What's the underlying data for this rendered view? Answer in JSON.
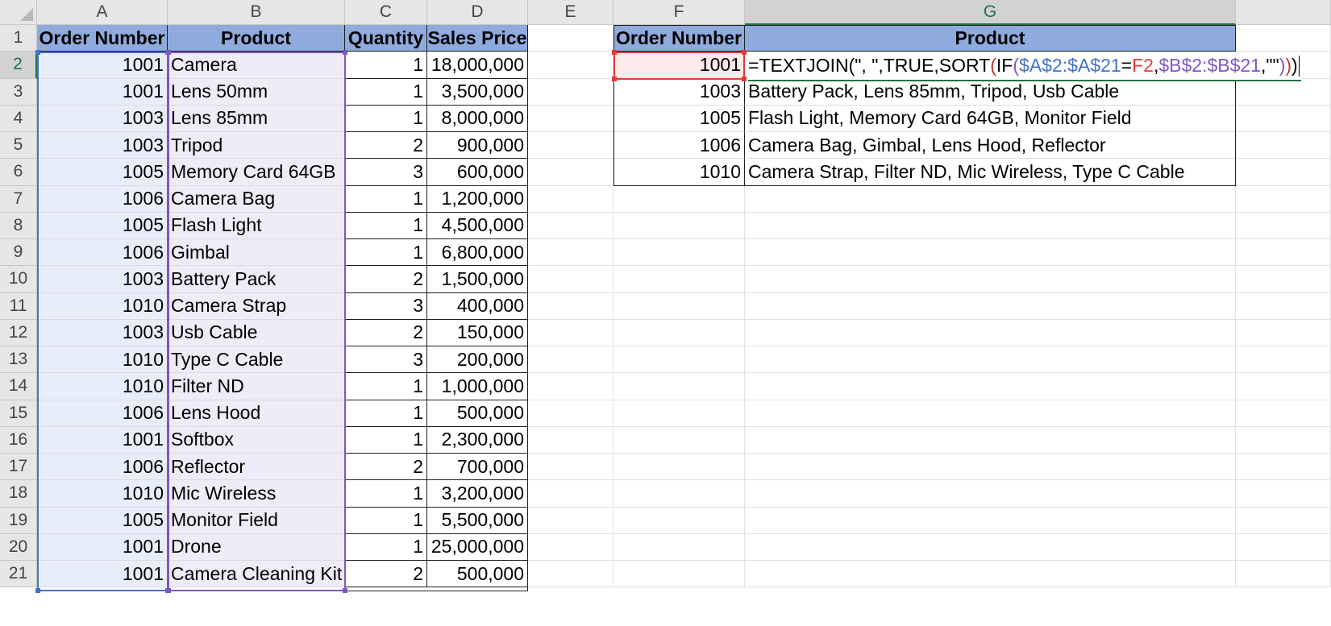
{
  "spreadsheet": {
    "columns": [
      {
        "letter": "A",
        "active": false
      },
      {
        "letter": "B",
        "active": false
      },
      {
        "letter": "C",
        "active": false
      },
      {
        "letter": "D",
        "active": false
      },
      {
        "letter": "E",
        "active": false
      },
      {
        "letter": "F",
        "active": false
      },
      {
        "letter": "G",
        "active": true
      }
    ],
    "row_numbers": [
      "1",
      "2",
      "3",
      "4",
      "5",
      "6",
      "7",
      "8",
      "9",
      "10",
      "11",
      "12",
      "13",
      "14",
      "15",
      "16",
      "17",
      "18",
      "19",
      "20",
      "21"
    ],
    "active_row": "2",
    "orders_table": {
      "headers": [
        "Order Number",
        "Product",
        "Quantity",
        "Sales Price"
      ],
      "rows": [
        [
          "1001",
          "Camera",
          "1",
          "18,000,000"
        ],
        [
          "1001",
          "Lens 50mm",
          "1",
          "3,500,000"
        ],
        [
          "1003",
          "Lens 85mm",
          "1",
          "8,000,000"
        ],
        [
          "1003",
          "Tripod",
          "2",
          "900,000"
        ],
        [
          "1005",
          "Memory Card 64GB",
          "3",
          "600,000"
        ],
        [
          "1006",
          "Camera Bag",
          "1",
          "1,200,000"
        ],
        [
          "1005",
          "Flash Light",
          "1",
          "4,500,000"
        ],
        [
          "1006",
          "Gimbal",
          "1",
          "6,800,000"
        ],
        [
          "1003",
          "Battery Pack",
          "2",
          "1,500,000"
        ],
        [
          "1010",
          "Camera Strap",
          "3",
          "400,000"
        ],
        [
          "1003",
          "Usb Cable",
          "2",
          "150,000"
        ],
        [
          "1010",
          "Type C Cable",
          "3",
          "200,000"
        ],
        [
          "1010",
          "Filter ND",
          "1",
          "1,000,000"
        ],
        [
          "1006",
          "Lens Hood",
          "1",
          "500,000"
        ],
        [
          "1001",
          "Softbox",
          "1",
          "2,300,000"
        ],
        [
          "1006",
          "Reflector",
          "2",
          "700,000"
        ],
        [
          "1010",
          "Mic Wireless",
          "1",
          "3,200,000"
        ],
        [
          "1005",
          "Monitor Field",
          "1",
          "5,500,000"
        ],
        [
          "1001",
          "Drone",
          "1",
          "25,000,000"
        ],
        [
          "1001",
          "Camera Cleaning Kit",
          "2",
          "500,000"
        ]
      ]
    },
    "summary_table": {
      "headers": [
        "Order Number",
        "Product"
      ],
      "rows": [
        [
          "1001",
          ""
        ],
        [
          "1003",
          "Battery Pack, Lens 85mm, Tripod, Usb Cable"
        ],
        [
          "1005",
          "Flash Light, Memory Card 64GB, Monitor Field"
        ],
        [
          "1006",
          "Camera Bag, Gimbal, Lens Hood, Reflector"
        ],
        [
          "1010",
          "Camera Strap, Filter ND, Mic Wireless, Type C Cable"
        ]
      ]
    },
    "formula": {
      "segments": [
        {
          "text": "=TEXTJOIN(\", \",TRUE,SORT",
          "color": "#000000"
        },
        {
          "text": "(",
          "color": "#c0392b"
        },
        {
          "text": "IF",
          "color": "#000000"
        },
        {
          "text": "(",
          "color": "#7e57c2"
        },
        {
          "text": "$A$2:$A$21",
          "color": "#4472c4"
        },
        {
          "text": "=",
          "color": "#000000"
        },
        {
          "text": "F2",
          "color": "#e03c3c"
        },
        {
          "text": ",",
          "color": "#000000"
        },
        {
          "text": "$B$2:$B$21",
          "color": "#7e57c2"
        },
        {
          "text": ",\"\"",
          "color": "#000000"
        },
        {
          "text": ")",
          "color": "#7e57c2"
        },
        {
          "text": ")",
          "color": "#c0392b"
        },
        {
          "text": ")",
          "color": "#000000"
        }
      ]
    },
    "colors": {
      "header_fill": "#8faadc",
      "range_a_fill": "#e8eef9",
      "range_b_fill": "#efebf7",
      "active_cell_fill": "#fde9e9",
      "range_a_border": "#4472c4",
      "range_b_border": "#7e57c2",
      "ref_f2_border": "#e03c3c",
      "accent_green": "#217346"
    }
  }
}
